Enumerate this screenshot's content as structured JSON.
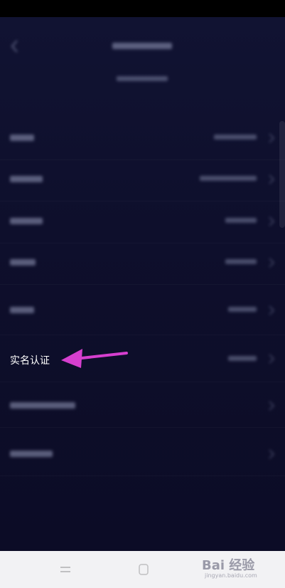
{
  "highlighted_row": {
    "label": "实名认证"
  },
  "watermark": {
    "brand": "Bai 经验",
    "url": "jingyan.baidu.com"
  },
  "colors": {
    "background": "#0c0c26",
    "arrow": "#d63fcf",
    "navbar": "#f2f2f4"
  },
  "icons": {
    "back": "chevron-left-icon",
    "row_chevron": "chevron-right-icon",
    "annotation": "arrow-left-icon"
  }
}
